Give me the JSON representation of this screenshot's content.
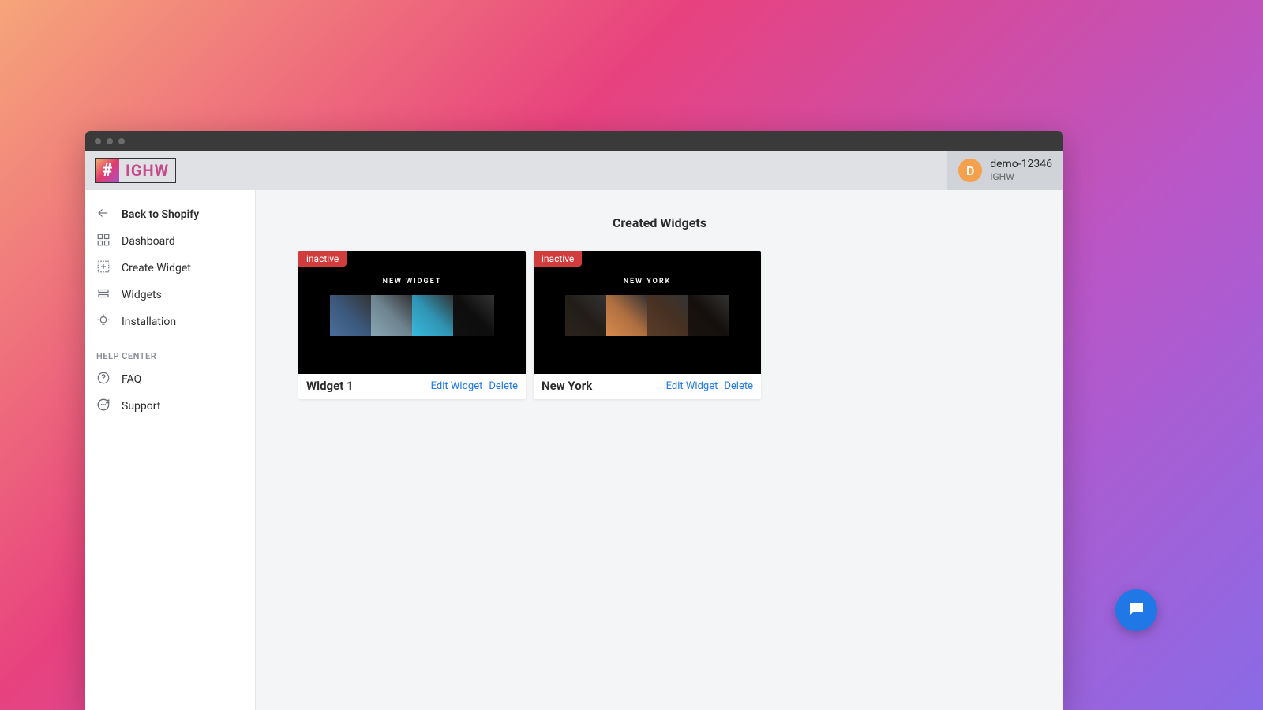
{
  "logo": {
    "hash": "#",
    "text": "IGHW"
  },
  "user": {
    "initial": "D",
    "name": "demo-12346",
    "subtitle": "IGHW"
  },
  "sidebar": {
    "items": [
      {
        "label": "Back to Shopify",
        "icon": "arrow-left",
        "bold": true
      },
      {
        "label": "Dashboard",
        "icon": "grid"
      },
      {
        "label": "Create Widget",
        "icon": "add-box"
      },
      {
        "label": "Widgets",
        "icon": "stack"
      },
      {
        "label": "Installation",
        "icon": "bulb"
      }
    ],
    "section_label": "HELP CENTER",
    "help_items": [
      {
        "label": "FAQ",
        "icon": "help-circle"
      },
      {
        "label": "Support",
        "icon": "chat-circle"
      }
    ]
  },
  "main": {
    "title": "Created Widgets",
    "edit_label": "Edit Widget",
    "delete_label": "Delete",
    "widgets": [
      {
        "status": "inactive",
        "preview_title": "NEW WIDGET",
        "name": "Widget 1",
        "thumb_colors": [
          "#4a6e9a",
          "#8aa6b4",
          "#3ab9df",
          "#111111"
        ]
      },
      {
        "status": "inactive",
        "preview_title": "NEW YORK",
        "name": "New York",
        "thumb_colors": [
          "#2b241e",
          "#d98a4f",
          "#5a3d2a",
          "#1a1410"
        ]
      }
    ]
  }
}
